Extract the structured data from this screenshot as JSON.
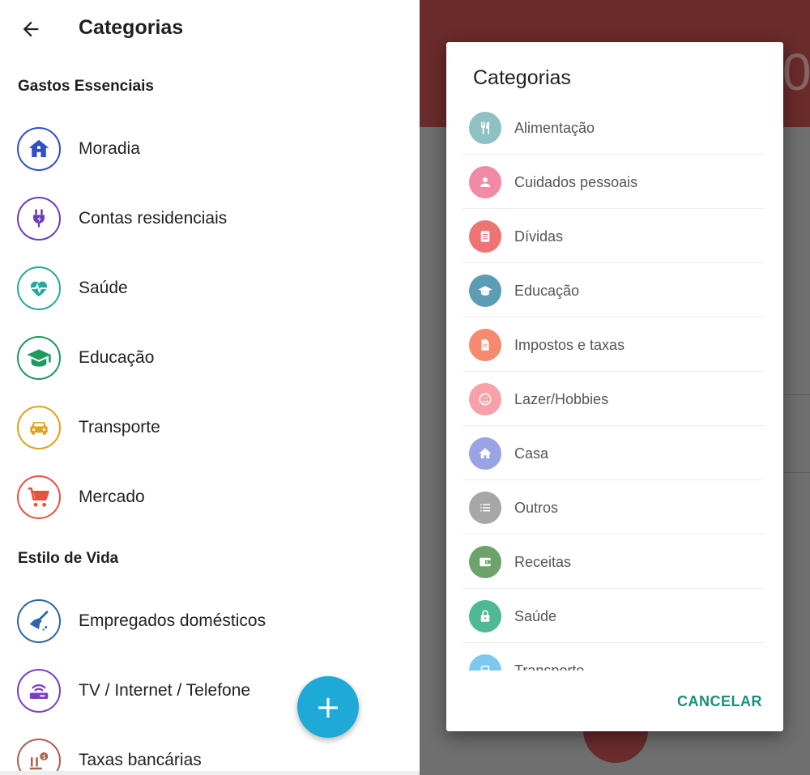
{
  "left_screen": {
    "title": "Categorias",
    "sections": [
      {
        "title": "Gastos Essenciais",
        "items": [
          {
            "label": "Moradia",
            "icon": "house-icon",
            "color": "#2f4fc7"
          },
          {
            "label": "Contas residenciais",
            "icon": "plug-icon",
            "color": "#6a3fb5"
          },
          {
            "label": "Saúde",
            "icon": "heartbeat-icon",
            "color": "#27a8a0"
          },
          {
            "label": "Educação",
            "icon": "graduation-cap-icon",
            "color": "#1e9a5e"
          },
          {
            "label": "Transporte",
            "icon": "car-icon",
            "color": "#e0a21a"
          },
          {
            "label": "Mercado",
            "icon": "shopping-cart-icon",
            "color": "#e8533f"
          }
        ]
      },
      {
        "title": "Estilo de Vida",
        "items": [
          {
            "label": "Empregados domésticos",
            "icon": "broom-icon",
            "color": "#2a67a8"
          },
          {
            "label": "TV / Internet / Telefone",
            "icon": "router-icon",
            "color": "#7a3fbf"
          },
          {
            "label": "Taxas bancárias",
            "icon": "bank-icon",
            "color": "#a8614f"
          }
        ]
      }
    ],
    "fab_label": "+"
  },
  "dialog": {
    "title": "Categorias",
    "items": [
      {
        "label": "Alimentação",
        "icon": "cutlery-icon",
        "color": "#8fc1c4"
      },
      {
        "label": "Cuidados pessoais",
        "icon": "person-icon",
        "color": "#f28aa5"
      },
      {
        "label": "Dívidas",
        "icon": "document-icon",
        "color": "#f07373"
      },
      {
        "label": "Educação",
        "icon": "graduation-cap-icon",
        "color": "#5c9db5"
      },
      {
        "label": "Impostos e taxas",
        "icon": "receipt-icon",
        "color": "#f58a6f"
      },
      {
        "label": "Lazer/Hobbies",
        "icon": "smiley-icon",
        "color": "#f7a1a9"
      },
      {
        "label": "Casa",
        "icon": "house-icon",
        "color": "#9aa3e3"
      },
      {
        "label": "Outros",
        "icon": "list-icon",
        "color": "#a7a7a7"
      },
      {
        "label": "Receitas",
        "icon": "wallet-icon",
        "color": "#6ba36b"
      },
      {
        "label": "Saúde",
        "icon": "lock-icon",
        "color": "#4fb895"
      },
      {
        "label": "Transporte",
        "icon": "bus-icon",
        "color": "#7cc8ef"
      }
    ],
    "cancel_label": "CANCELAR"
  }
}
